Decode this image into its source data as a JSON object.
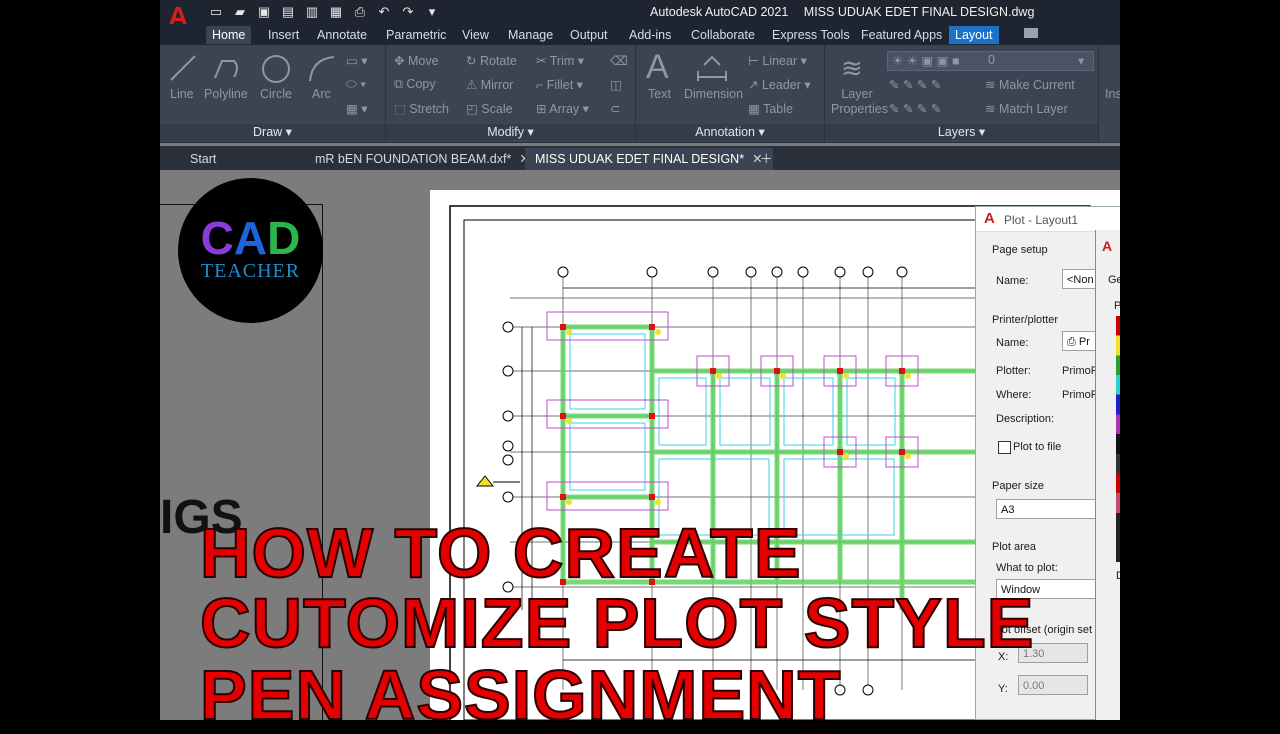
{
  "title_bar": {
    "app": "Autodesk AutoCAD 2021",
    "file": "MISS UDUAK EDET FINAL DESIGN.dwg",
    "logo": "A"
  },
  "ribbon_tabs": [
    "Home",
    "Insert",
    "Annotate",
    "Parametric",
    "View",
    "Manage",
    "Output",
    "Add-ins",
    "Collaborate",
    "Express Tools",
    "Featured Apps",
    "Layout"
  ],
  "draw_panel": {
    "title": "Draw",
    "tools": [
      "Line",
      "Polyline",
      "Circle",
      "Arc"
    ]
  },
  "modify_panel": {
    "title": "Modify",
    "tools": [
      "Move",
      "Rotate",
      "Trim",
      "Copy",
      "Mirror",
      "Fillet",
      "Stretch",
      "Scale",
      "Array"
    ]
  },
  "annotation_panel": {
    "title": "Annotation",
    "tools": [
      "Text",
      "Dimension",
      "Linear",
      "Leader",
      "Table"
    ]
  },
  "layers_panel": {
    "title": "Layers",
    "tools": [
      "Layer Properties",
      "Make Current",
      "Match Layer"
    ],
    "layer_value": "0"
  },
  "next_panel_label": "Ins",
  "doc_tabs": [
    {
      "label": "Start"
    },
    {
      "label": "mR bEN FOUNDATION BEAM.dxf*"
    },
    {
      "label": "MISS UDUAK EDET FINAL DESIGN*"
    }
  ],
  "badge": {
    "top": "CAD",
    "bottom": "TEACHER"
  },
  "plot_dialog": {
    "title": "Plot - Layout1",
    "page_setup": "Page setup",
    "name_label": "Name:",
    "name_value": "<Non",
    "printer_plotter": "Printer/plotter",
    "printer_name_label": "Name:",
    "printer_name_value": "Pr",
    "plotter_label": "Plotter:",
    "plotter_value": "PrimoP",
    "where_label": "Where:",
    "where_value": "PrimoP",
    "description_label": "Description:",
    "plot_to_file": "Plot to file",
    "paper_size": "Paper size",
    "paper_value": "A3",
    "plot_area": "Plot area",
    "what_to_plot": "What to plot:",
    "what_value": "Window",
    "plot_offset": "Plot offset (origin set",
    "x_label": "X:",
    "x_value": "1.30",
    "y_label": "Y:",
    "y_value": "0.00"
  },
  "second_dialog": {
    "logo": "A",
    "tab": "Ge",
    "label_p": "P",
    "label_d": "D"
  },
  "overlay": {
    "line1": "HOW TO CREATE",
    "line2": "CUTOMIZE PLOT STYLE",
    "line3": "PEN ASSIGNMENT",
    "bg_partial": "IGS"
  },
  "colors": {
    "overlay_red": "#e40000",
    "layout_tab": "#1a72c9",
    "ribbon": "#3b4453"
  }
}
